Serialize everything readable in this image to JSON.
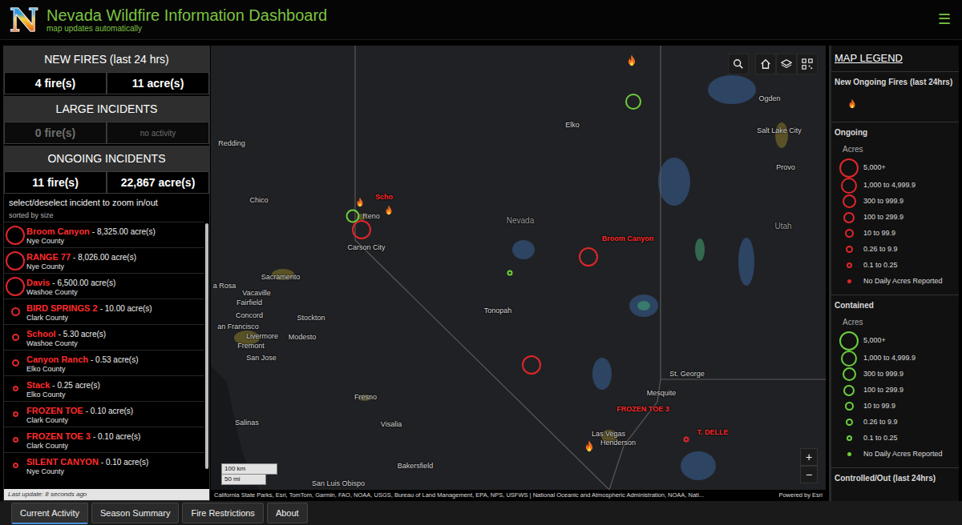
{
  "header": {
    "logo": "N",
    "title": "Nevada Wildfire Information Dashboard",
    "subtitle": "map updates automatically",
    "menu": "☰"
  },
  "summary": [
    {
      "title": "NEW FIRES (last 24 hrs)",
      "fires": "4 fire(s)",
      "acres": "11 acre(s)",
      "muted": false
    },
    {
      "title": "LARGE INCIDENTS",
      "fires": "0 fire(s)",
      "acres": "no activity",
      "muted": true
    },
    {
      "title": "ONGOING INCIDENTS",
      "fires": "11 fire(s)",
      "acres": "22,867 acre(s)",
      "muted": false
    }
  ],
  "incidents": {
    "hint": "select/deselect incident to zoom in/out",
    "sort": "sorted by size",
    "items": [
      {
        "name": "Broom Canyon",
        "acres": "- 8,325.00 acre(s)",
        "county": "Nye County",
        "size": "xxl"
      },
      {
        "name": "RANGE 77",
        "acres": "- 8,026.00 acre(s)",
        "county": "Nye County",
        "size": "xxl"
      },
      {
        "name": "Davis",
        "acres": "- 6,500.00 acre(s)",
        "county": "Washoe County",
        "size": "xxl"
      },
      {
        "name": "BIRD SPRINGS 2",
        "acres": "- 10.00 acre(s)",
        "county": "Clark County",
        "size": "s"
      },
      {
        "name": "School",
        "acres": "- 5.30 acre(s)",
        "county": "Washoe County",
        "size": "xs"
      },
      {
        "name": "Canyon Ranch",
        "acres": "- 0.53 acre(s)",
        "county": "Elko County",
        "size": "xs"
      },
      {
        "name": "Stack",
        "acres": "- 0.25 acre(s)",
        "county": "Elko County",
        "size": "xxs"
      },
      {
        "name": "FROZEN TOE",
        "acres": "- 0.10 acre(s)",
        "county": "Clark County",
        "size": "xxs"
      },
      {
        "name": "FROZEN TOE 3",
        "acres": "- 0.10 acre(s)",
        "county": "Clark County",
        "size": "xxs"
      },
      {
        "name": "SILENT CANYON",
        "acres": "- 0.10 acre(s)",
        "county": "Nye County",
        "size": "xxs"
      }
    ],
    "last_update": "Last update: 8 seconds ago"
  },
  "map": {
    "labels": [
      {
        "text": "Ogden",
        "kind": "city"
      },
      {
        "text": "Salt Lake City",
        "kind": "city"
      },
      {
        "text": "Provo",
        "kind": "city"
      },
      {
        "text": "Elko",
        "kind": "city"
      },
      {
        "text": "Redding",
        "kind": "city"
      },
      {
        "text": "Chico",
        "kind": "city"
      },
      {
        "text": "Reno",
        "kind": "city"
      },
      {
        "text": "Carson City",
        "kind": "city"
      },
      {
        "text": "Nevada",
        "kind": "state"
      },
      {
        "text": "Utah",
        "kind": "state"
      },
      {
        "text": "Sacramento",
        "kind": "city"
      },
      {
        "text": "a Rosa",
        "kind": "city"
      },
      {
        "text": "Vacaville",
        "kind": "city"
      },
      {
        "text": "Fairfield",
        "kind": "city"
      },
      {
        "text": "an Francisco",
        "kind": "city"
      },
      {
        "text": "Concord",
        "kind": "city"
      },
      {
        "text": "Stockton",
        "kind": "city"
      },
      {
        "text": "Livermore",
        "kind": "city"
      },
      {
        "text": "Modesto",
        "kind": "city"
      },
      {
        "text": "Fremont",
        "kind": "city"
      },
      {
        "text": "San Jose",
        "kind": "city"
      },
      {
        "text": "Tonopah",
        "kind": "city"
      },
      {
        "text": "Fresno",
        "kind": "city"
      },
      {
        "text": "Visalia",
        "kind": "city"
      },
      {
        "text": "Salinas",
        "kind": "city"
      },
      {
        "text": "Bakersfield",
        "kind": "city"
      },
      {
        "text": "San Luis Obispo",
        "kind": "city"
      },
      {
        "text": "St. George",
        "kind": "city"
      },
      {
        "text": "Mesquite",
        "kind": "city"
      },
      {
        "text": "Las Vegas",
        "kind": "city"
      },
      {
        "text": "Henderson",
        "kind": "city"
      },
      {
        "text": "Scho",
        "kind": "fire"
      },
      {
        "text": "Broom Canyon",
        "kind": "fire"
      },
      {
        "text": "FROZEN TOE 3",
        "kind": "fire"
      },
      {
        "text": "T. DELLE",
        "kind": "fire"
      }
    ],
    "markers": [
      {
        "kind": "new",
        "size": "m"
      },
      {
        "kind": "contained",
        "size": "xl"
      },
      {
        "kind": "contained",
        "size": "l"
      },
      {
        "kind": "new",
        "size": "s"
      },
      {
        "kind": "new",
        "size": "s"
      },
      {
        "kind": "ongoing",
        "size": "xxl"
      },
      {
        "kind": "ongoing",
        "size": "xxl"
      },
      {
        "kind": "contained",
        "size": "xxs"
      },
      {
        "kind": "ongoing",
        "size": "xxl"
      },
      {
        "kind": "new",
        "size": "m"
      },
      {
        "kind": "ongoing",
        "size": "xxs"
      }
    ],
    "scale": {
      "km": "100 km",
      "mi": "50 mi"
    },
    "zoom": [
      "+",
      "−"
    ],
    "attribution": "California State Parks, Esri, TomTom, Garmin, FAO, NOAA, USGS, Bureau of Land Management, EPA, NPS, USFWS | National Oceanic and Atmospheric Administration, NOAA, Nati...",
    "powered": "Powered by Esri"
  },
  "legend": {
    "title": "MAP LEGEND",
    "new_title": "New Ongoing Fires (last 24hrs)",
    "sections": [
      {
        "title": "Ongoing",
        "unit": "Acres",
        "kind": "ongoing",
        "items": [
          {
            "label": "5,000+",
            "size": "xxl"
          },
          {
            "label": "1,000 to 4,999.9",
            "size": "xl"
          },
          {
            "label": "300 to 999.9",
            "size": "l"
          },
          {
            "label": "100 to 299.9",
            "size": "m"
          },
          {
            "label": "10 to 99.9",
            "size": "s"
          },
          {
            "label": "0.26 to 9.9",
            "size": "xs"
          },
          {
            "label": "0.1 to 0.25",
            "size": "xxs"
          },
          {
            "label": "No Daily Acres Reported",
            "size": "dot"
          }
        ]
      },
      {
        "title": "Contained",
        "unit": "Acres",
        "kind": "contained",
        "items": [
          {
            "label": "5,000+",
            "size": "xxl"
          },
          {
            "label": "1,000 to 4,999.9",
            "size": "xl"
          },
          {
            "label": "300 to 999.9",
            "size": "l"
          },
          {
            "label": "100 to 299.9",
            "size": "m"
          },
          {
            "label": "10 to 99.9",
            "size": "s"
          },
          {
            "label": "0.26 to 9.9",
            "size": "xs"
          },
          {
            "label": "0.1 to 0.25",
            "size": "xxs"
          },
          {
            "label": "No Daily Acres Reported",
            "size": "dot"
          }
        ]
      }
    ],
    "out_title": "Controlled/Out (last 24hrs)"
  },
  "tabs": [
    {
      "label": "Current Activity",
      "selected": true
    },
    {
      "label": "Season Summary",
      "selected": false
    },
    {
      "label": "Fire Restrictions",
      "selected": false
    },
    {
      "label": "About",
      "selected": false
    }
  ]
}
